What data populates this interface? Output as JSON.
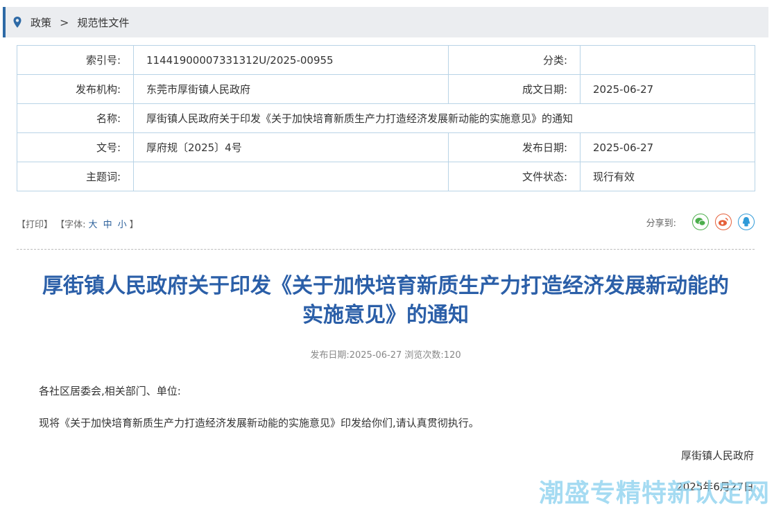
{
  "breadcrumb": {
    "items": [
      "政策",
      "规范性文件"
    ],
    "separator": ">"
  },
  "meta": {
    "index_label": "索引号:",
    "index_value": "11441900007331312U/2025-00955",
    "category_label": "分类:",
    "category_value": "",
    "publisher_label": "发布机构:",
    "publisher_value": "东莞市厚街镇人民政府",
    "written_date_label": "成文日期:",
    "written_date_value": "2025-06-27",
    "name_label": "名称:",
    "name_value": "厚街镇人民政府关于印发《关于加快培育新质生产力打造经济发展新动能的实施意见》的通知",
    "doc_no_label": "文号:",
    "doc_no_value": "厚府规〔2025〕4号",
    "publish_date_label": "发布日期:",
    "publish_date_value": "2025-06-27",
    "keywords_label": "主题词:",
    "keywords_value": "",
    "status_label": "文件状态:",
    "status_value": "现行有效"
  },
  "toolbar": {
    "print": "【打印】",
    "font_prefix": "【字体:",
    "font_large": "大",
    "font_medium": "中",
    "font_small": "小",
    "font_suffix": "】",
    "share_label": "分享到:",
    "share_icons": [
      "wechat-icon",
      "weibo-icon",
      "qq-icon"
    ],
    "colors": {
      "wechat": "#4cae4c",
      "weibo": "#e5603a",
      "qq": "#2f9ad8"
    }
  },
  "article": {
    "title_line1": "厚街镇人民政府关于印发《关于加快培育新质生产力打造经济发展新动能的",
    "title_line2": "实施意见》的通知",
    "info": "发布日期:2025-06-27 浏览次数:120",
    "salutation": "各社区居委会,相关部门、单位:",
    "body": "现将《关于加快培育新质生产力打造经济发展新动能的实施意见》印发给你们,请认真贯彻执行。",
    "signature": "厚街镇人民政府",
    "date": "2025年6月27日"
  },
  "watermark": "潮盛专精特新认定网",
  "colors": {
    "accent": "#2e6aa6",
    "title": "#2b5fa8",
    "border": "#b8d3e6"
  }
}
